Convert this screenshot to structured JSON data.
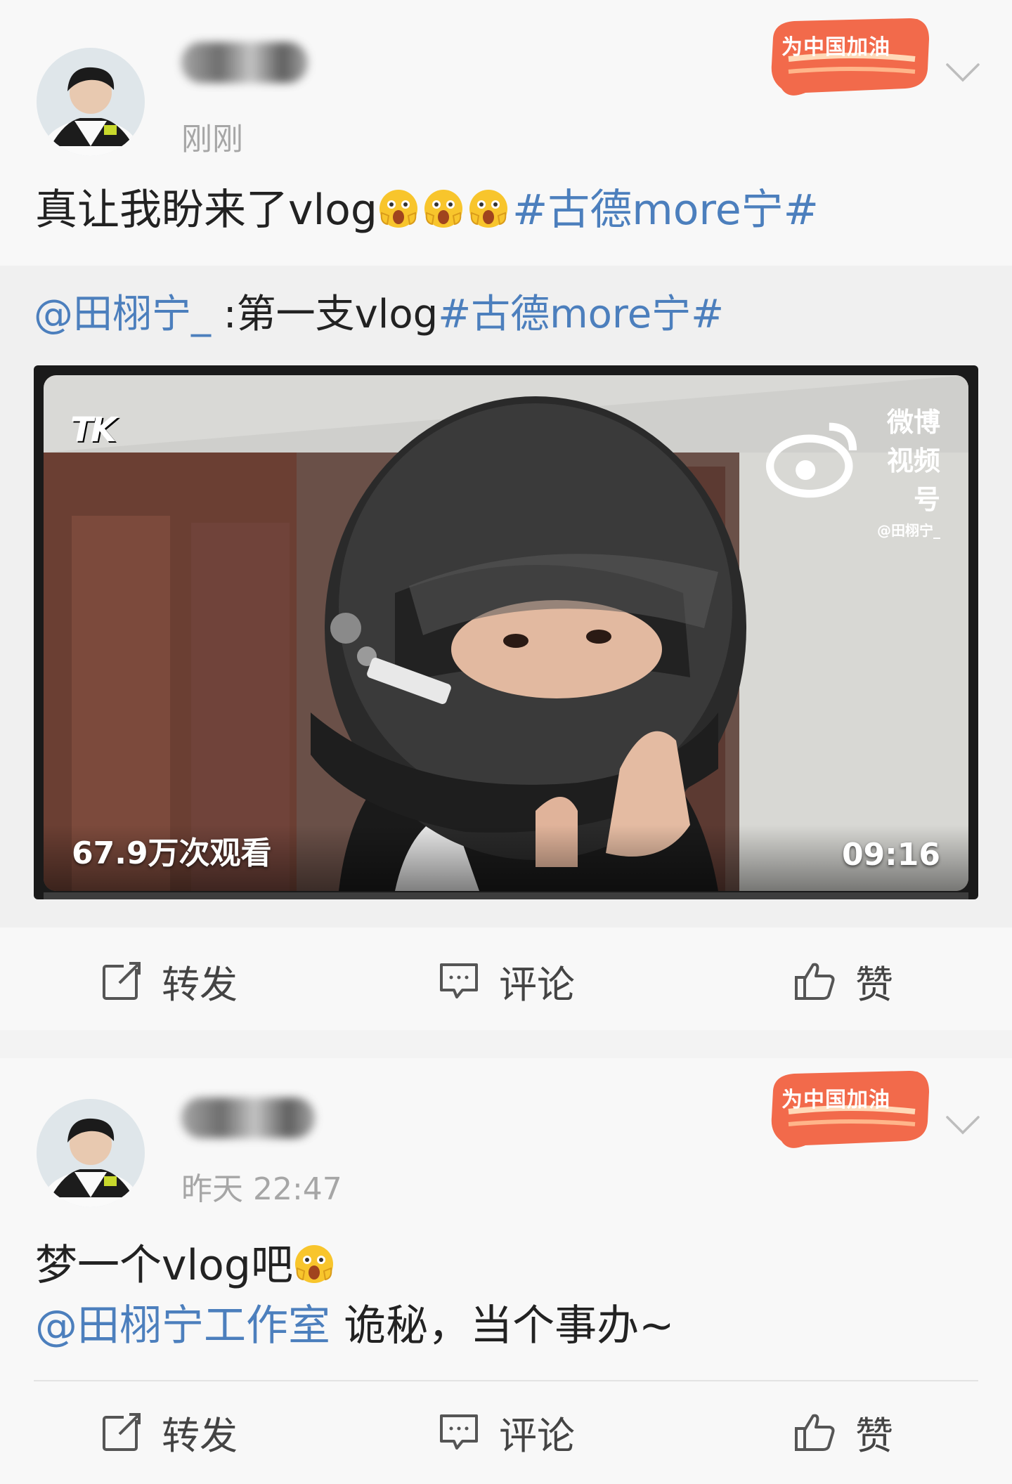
{
  "post1": {
    "timestamp": "刚刚",
    "badge": "为中国加油",
    "text": "真让我盼来了vlog",
    "hashtag": "#古德more宁#",
    "emojis": [
      "scared-face-emoji",
      "scared-face-emoji",
      "scared-face-emoji"
    ],
    "repost": {
      "mention": "@田栩宁_",
      "text": " :第一支vlog",
      "hashtag": "#古德more宁#",
      "video": {
        "logo": "TK",
        "platform": "微博视频号",
        "account": "@田栩宁_",
        "views": "67.9万次观看",
        "duration": "09:16"
      }
    },
    "actions": {
      "repost": "转发",
      "comment": "评论",
      "like": "赞"
    }
  },
  "post2": {
    "timestamp": "昨天 22:47",
    "badge": "为中国加油",
    "line1": "梦一个vlog吧",
    "mention": "@田栩宁工作室",
    "line2": " 诡秘，当个事办~",
    "actions": {
      "repost": "转发",
      "comment": "评论",
      "like": "赞"
    }
  },
  "colors": {
    "link": "#4c7fbd",
    "badge": "#f26a4b",
    "background": "#f8f8f8"
  }
}
